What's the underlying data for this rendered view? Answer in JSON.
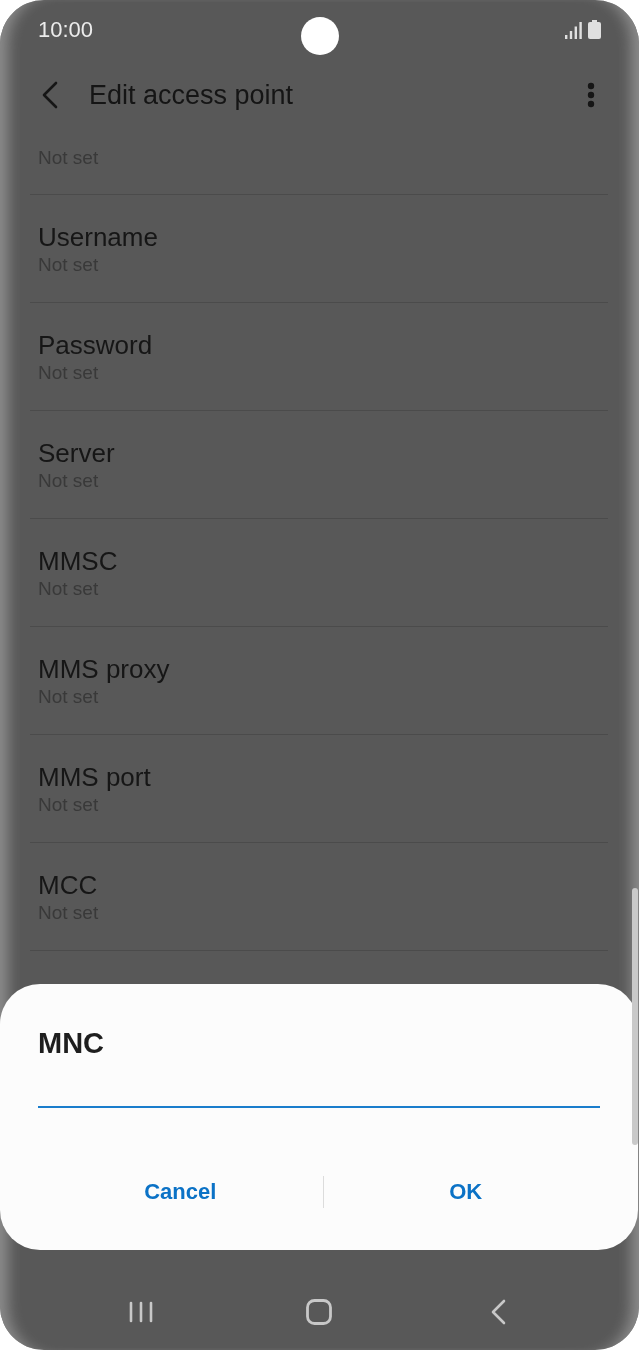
{
  "status_bar": {
    "time": "10:00"
  },
  "header": {
    "title": "Edit access point"
  },
  "list": {
    "items": [
      {
        "value": "Not set"
      },
      {
        "title": "Username",
        "value": "Not set"
      },
      {
        "title": "Password",
        "value": "Not set"
      },
      {
        "title": "Server",
        "value": "Not set"
      },
      {
        "title": "MMSC",
        "value": "Not set"
      },
      {
        "title": "MMS proxy",
        "value": "Not set"
      },
      {
        "title": "MMS port",
        "value": "Not set"
      },
      {
        "title": "MCC",
        "value": "Not set"
      }
    ]
  },
  "dialog": {
    "title": "MNC",
    "field": {
      "focused": true
    },
    "buttons": [
      "Cancel",
      "OK"
    ]
  }
}
